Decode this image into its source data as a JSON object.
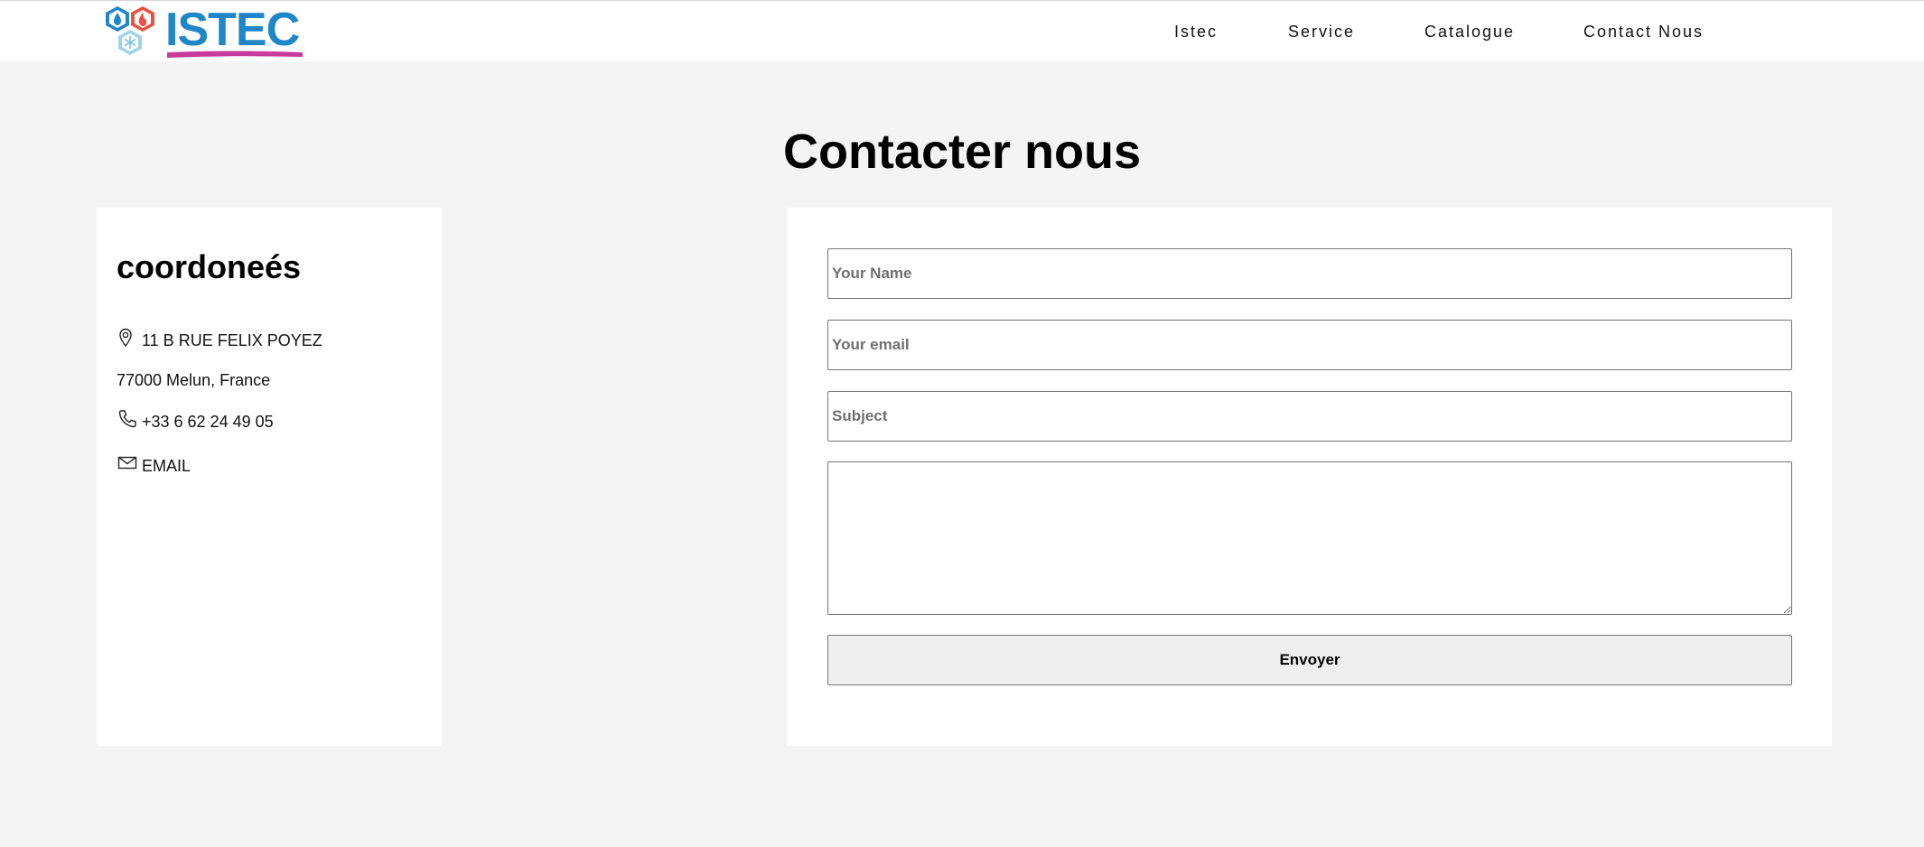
{
  "header": {
    "logo_text": "ISTEC",
    "nav": [
      {
        "label": "Istec"
      },
      {
        "label": "Service"
      },
      {
        "label": "Catalogue"
      },
      {
        "label": "Contact Nous"
      }
    ]
  },
  "page": {
    "title": "Contacter nous"
  },
  "contact_info": {
    "title": "coordoneés",
    "address_line1": "11 B RUE FELIX POYEZ",
    "address_line2": "77000 Melun, France",
    "phone": "+33 6 62 24 49 05",
    "email_label": "EMAIL",
    "icons": [
      "location-pin-icon",
      "phone-icon",
      "envelope-icon"
    ]
  },
  "form": {
    "name_placeholder": "Your Name",
    "email_placeholder": "Your email",
    "subject_placeholder": "Subject",
    "message_placeholder": "",
    "submit_label": "Envoyer"
  },
  "colors": {
    "background": "#f4f4f4",
    "card": "#ffffff",
    "logo_blue": "#1f86c8",
    "logo_underline": "#c83b9a",
    "logo_red": "#e8533f",
    "logo_light_blue": "#9fd3ee"
  }
}
